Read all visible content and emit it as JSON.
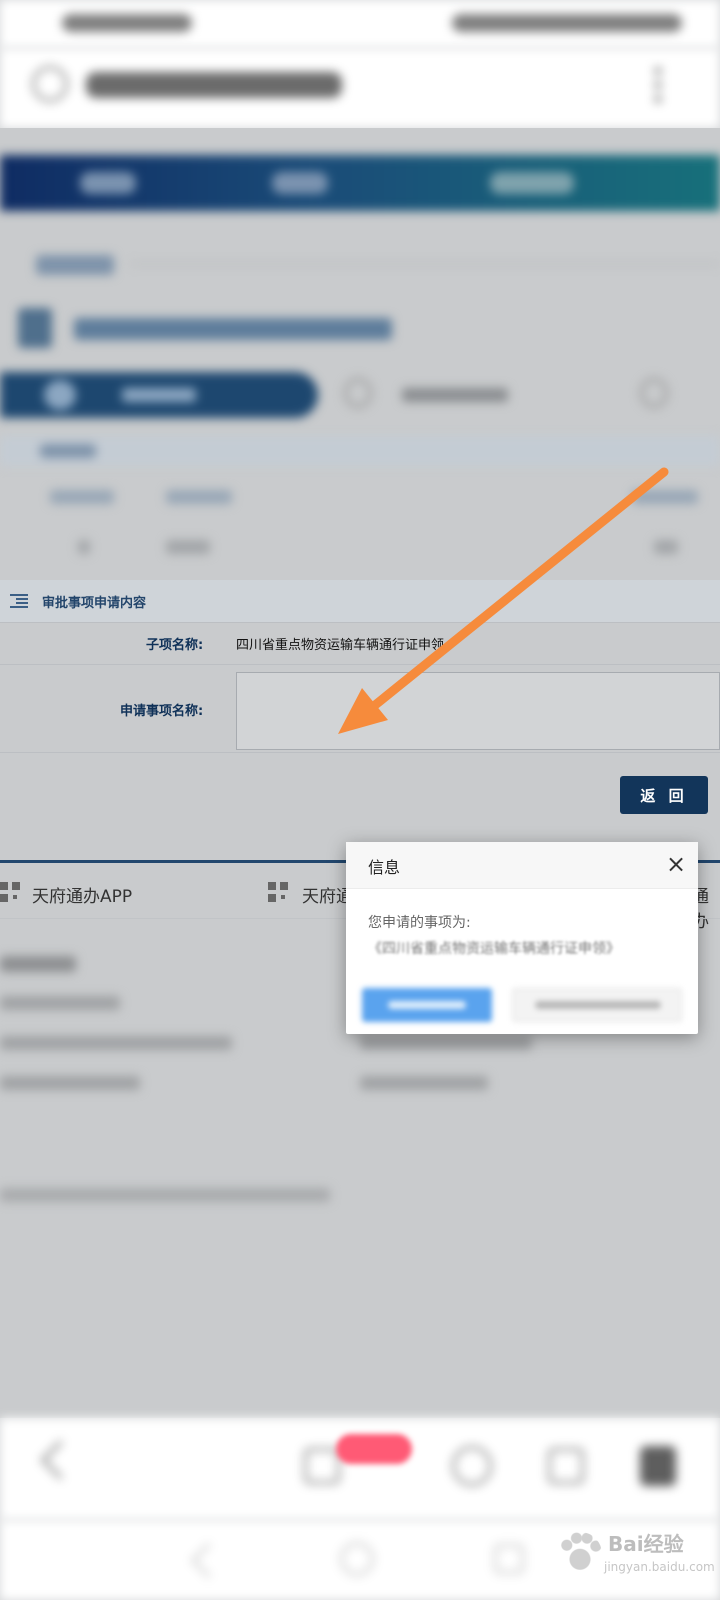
{
  "form": {
    "section_title": "审批事项申请内容",
    "subitem_label": "子项名称:",
    "subitem_value": "四川省重点物资运输车辆通行证申领",
    "apply_label": "申请事项名称:",
    "return_label": "返 回"
  },
  "footer": {
    "app1": "天府通办APP",
    "app2": "天府通",
    "app3_partial": "通办"
  },
  "dialog": {
    "title": "信息",
    "close_icon": "×",
    "message": "您申请的事项为:",
    "item": "《四川省重点物资运输车辆通行证申领》"
  },
  "annotation": {
    "arrow_color": "#f68b3c"
  },
  "watermark": {
    "brand": "Bai经验",
    "sub": "jingyan.baidu.com"
  }
}
